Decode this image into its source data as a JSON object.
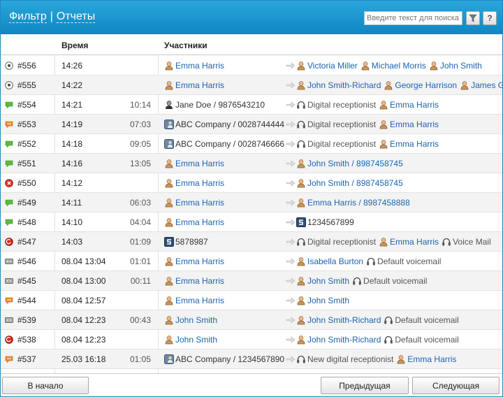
{
  "header": {
    "tab_filter": "Фильтр",
    "separator": "|",
    "tab_reports": "Отчеты",
    "search_placeholder": "Введите текст для поиска",
    "help_label": "?"
  },
  "columns": {
    "time": "Время",
    "participants": "Участники"
  },
  "rows": [
    {
      "id": "#556",
      "time": "14:26",
      "duration": "",
      "status": "soccer",
      "from": [
        {
          "type": "user",
          "text": "Emma Harris",
          "link": true
        }
      ],
      "to": [
        {
          "type": "user",
          "text": "Victoria Miller",
          "link": true
        },
        {
          "type": "user",
          "text": "Michael Morris",
          "link": true
        },
        {
          "type": "user",
          "text": "John Smith",
          "link": true
        }
      ]
    },
    {
      "id": "#555",
      "time": "14:22",
      "duration": "",
      "status": "soccer",
      "from": [
        {
          "type": "user",
          "text": "Emma Harris",
          "link": true
        }
      ],
      "to": [
        {
          "type": "user",
          "text": "John Smith-Richard",
          "link": true
        },
        {
          "type": "user",
          "text": "George Harrison",
          "link": true
        },
        {
          "type": "user",
          "text": "James Green",
          "link": true
        }
      ]
    },
    {
      "id": "#554",
      "time": "14:21",
      "duration": "10:14",
      "status": "green",
      "from": [
        {
          "type": "dark",
          "text": "Jane Doe / 9876543210",
          "link": false
        }
      ],
      "to": [
        {
          "type": "headset",
          "text": "Digital receptionist",
          "link": false
        },
        {
          "type": "user",
          "text": "Emma Harris",
          "link": true
        }
      ]
    },
    {
      "id": "#553",
      "time": "14:19",
      "duration": "07:03",
      "status": "orange",
      "from": [
        {
          "type": "company",
          "text": "ABC Company / 0028744444",
          "link": false
        }
      ],
      "to": [
        {
          "type": "headset",
          "text": "Digital receptionist",
          "link": false
        },
        {
          "type": "user",
          "text": "Emma Harris",
          "link": true
        }
      ]
    },
    {
      "id": "#552",
      "time": "14:18",
      "duration": "09:05",
      "status": "green",
      "from": [
        {
          "type": "company",
          "text": "ABC Company / 0028746666",
          "link": false
        }
      ],
      "to": [
        {
          "type": "headset",
          "text": "Digital receptionist",
          "link": false
        },
        {
          "type": "user",
          "text": "Emma Harris",
          "link": true
        }
      ]
    },
    {
      "id": "#551",
      "time": "14:16",
      "duration": "13:05",
      "status": "green",
      "from": [
        {
          "type": "user",
          "text": "Emma Harris",
          "link": true
        }
      ],
      "to": [
        {
          "type": "user",
          "text": "John Smith / 8987458745",
          "link": true
        }
      ]
    },
    {
      "id": "#550",
      "time": "14:12",
      "duration": "",
      "status": "red",
      "from": [
        {
          "type": "user",
          "text": "Emma Harris",
          "link": true
        }
      ],
      "to": [
        {
          "type": "user",
          "text": "John Smith / 8987458745",
          "link": true
        }
      ]
    },
    {
      "id": "#549",
      "time": "14:11",
      "duration": "06:03",
      "status": "green",
      "from": [
        {
          "type": "user",
          "text": "Emma Harris",
          "link": true
        }
      ],
      "to": [
        {
          "type": "user",
          "text": "Emma Harris / 8987458888",
          "link": true
        }
      ]
    },
    {
      "id": "#548",
      "time": "14:10",
      "duration": "04:04",
      "status": "green",
      "from": [
        {
          "type": "user",
          "text": "Emma Harris",
          "link": true
        }
      ],
      "to": [
        {
          "type": "sbox",
          "text": "1234567899",
          "link": false
        }
      ]
    },
    {
      "id": "#547",
      "time": "14:03",
      "duration": "01:09",
      "status": "redcircle",
      "from": [
        {
          "type": "sbox",
          "text": "5878987",
          "link": false
        }
      ],
      "to": [
        {
          "type": "headset",
          "text": "Digital receptionist",
          "link": false
        },
        {
          "type": "user",
          "text": "Emma Harris",
          "link": true
        },
        {
          "type": "headset",
          "text": "Voice Mail",
          "link": false
        }
      ]
    },
    {
      "id": "#546",
      "time": "08.04 13:04",
      "duration": "01:01",
      "status": "tape",
      "from": [
        {
          "type": "user",
          "text": "Emma Harris",
          "link": true
        }
      ],
      "to": [
        {
          "type": "user",
          "text": "Isabella Burton",
          "link": true
        },
        {
          "type": "headset",
          "text": "Default voicemail",
          "link": false
        }
      ]
    },
    {
      "id": "#545",
      "time": "08.04 13:00",
      "duration": "00:11",
      "status": "tape",
      "from": [
        {
          "type": "user",
          "text": "Emma Harris",
          "link": true
        }
      ],
      "to": [
        {
          "type": "user",
          "text": "John Smith",
          "link": true
        },
        {
          "type": "headset",
          "text": "Default voicemail",
          "link": false
        }
      ]
    },
    {
      "id": "#544",
      "time": "08.04 12:57",
      "duration": "",
      "status": "orange",
      "from": [
        {
          "type": "user",
          "text": "Emma Harris",
          "link": true
        }
      ],
      "to": [
        {
          "type": "user",
          "text": "John Smith",
          "link": true
        }
      ]
    },
    {
      "id": "#539",
      "time": "08.04 12:23",
      "duration": "00:43",
      "status": "tape",
      "from": [
        {
          "type": "user",
          "text": "John Smith",
          "link": true
        }
      ],
      "to": [
        {
          "type": "user",
          "text": "John Smith-Richard",
          "link": true
        },
        {
          "type": "headset",
          "text": "Default voicemail",
          "link": false
        }
      ]
    },
    {
      "id": "#538",
      "time": "08.04 12:23",
      "duration": "",
      "status": "redcircle",
      "from": [
        {
          "type": "user",
          "text": "John Smith",
          "link": true
        }
      ],
      "to": [
        {
          "type": "user",
          "text": "John Smith-Richard",
          "link": true
        },
        {
          "type": "headset",
          "text": "Default voicemail",
          "link": false
        }
      ]
    },
    {
      "id": "#537",
      "time": "25.03 16:18",
      "duration": "01:05",
      "status": "orange",
      "from": [
        {
          "type": "company",
          "text": "ABC Company / 1234567890",
          "link": false
        }
      ],
      "to": [
        {
          "type": "headset",
          "text": "New digital receptionist",
          "link": false
        },
        {
          "type": "user",
          "text": "Emma Harris",
          "link": true
        }
      ]
    }
  ],
  "footer": {
    "first": "В начало",
    "prev": "Предыдущая",
    "next": "Следующая"
  },
  "colors": {
    "header_top": "#2aa7dc",
    "header_bottom": "#0f86c2",
    "link": "#1a64b5",
    "alt_row": "#f3f3f3"
  }
}
